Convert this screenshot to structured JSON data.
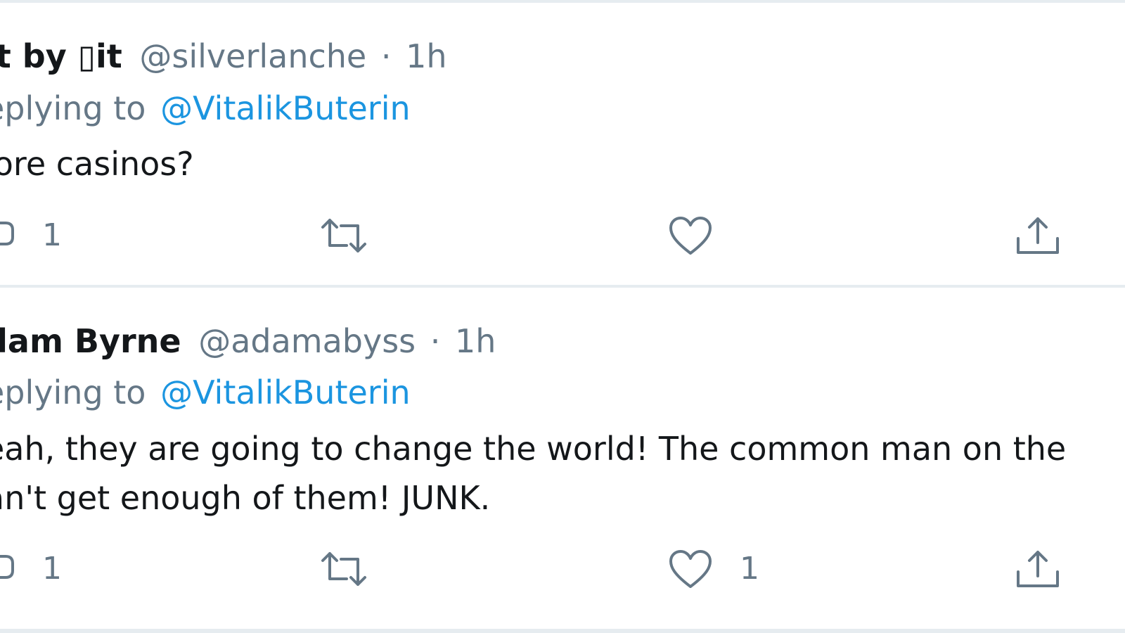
{
  "tweets": [
    {
      "name": "it by ▯it",
      "handle": "@silverlanche",
      "separator": "·",
      "time": "1h",
      "replying_label": "eplying to",
      "replying_to": "@VitalikButerin",
      "text_lines": [
        "lore casinos?"
      ],
      "reply_count": "1",
      "retweet_count": "",
      "like_count": ""
    },
    {
      "name": "dam Byrne",
      "handle": "@adamabyss",
      "separator": "·",
      "time": "1h",
      "replying_label": "eplying to",
      "replying_to": "@VitalikButerin",
      "text_lines": [
        "eah, they are going to change the world! The common man on the",
        "an't get enough of them! JUNK."
      ],
      "reply_count": "1",
      "retweet_count": "",
      "like_count": "1"
    }
  ],
  "icons": {
    "reply": "reply-icon",
    "retweet": "retweet-icon",
    "like": "heart-icon",
    "share": "share-icon"
  },
  "colors": {
    "text": "#14171a",
    "muted": "#657786",
    "link": "#1b95e0",
    "divider": "#e6ecf0"
  }
}
